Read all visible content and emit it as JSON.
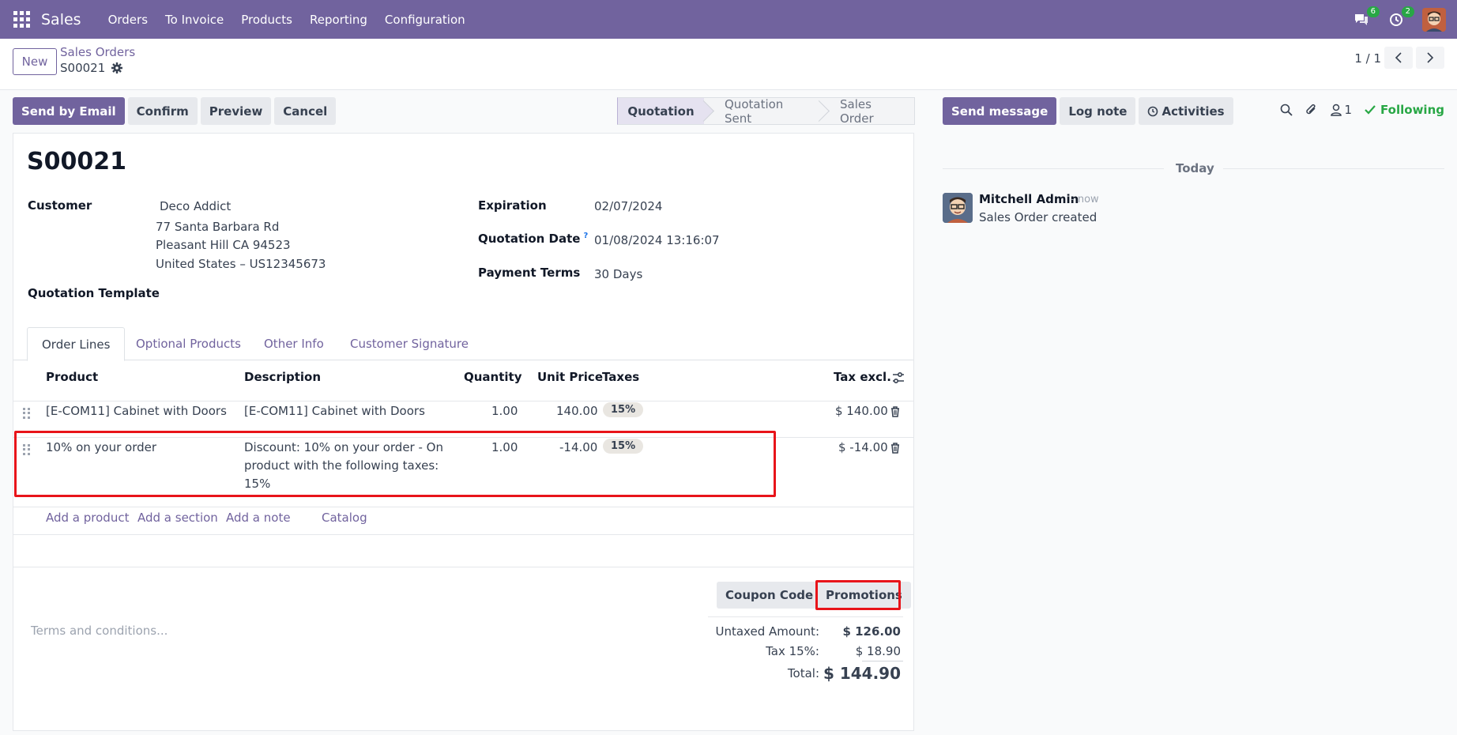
{
  "navbar": {
    "app_name": "Sales",
    "menu": [
      "Orders",
      "To Invoice",
      "Products",
      "Reporting",
      "Configuration"
    ],
    "messages_badge": "6",
    "activities_badge": "2",
    "icons": [
      "apps-grid-icon",
      "chat-icon",
      "clock-icon",
      "user-avatar"
    ]
  },
  "control_panel": {
    "new_label": "New",
    "breadcrumb_parent": "Sales Orders",
    "breadcrumb_current": "S00021",
    "pager": "1 / 1"
  },
  "actions": {
    "send_email": "Send by Email",
    "confirm": "Confirm",
    "preview": "Preview",
    "cancel": "Cancel"
  },
  "statusbar": {
    "stages": [
      "Quotation",
      "Quotation Sent",
      "Sales Order"
    ],
    "active": "Quotation"
  },
  "form": {
    "name": "S00021",
    "customer_label": "Customer",
    "customer_name": "Deco Addict",
    "customer_address_1": "77 Santa Barbara Rd",
    "customer_address_2": "Pleasant Hill CA 94523",
    "customer_address_3": "United States – US12345673",
    "template_label": "Quotation Template",
    "expiration_label": "Expiration",
    "expiration_value": "02/07/2024",
    "quotation_date_label": "Quotation Date",
    "quotation_date_help": "?",
    "quotation_date_value": "01/08/2024 13:16:07",
    "payment_terms_label": "Payment Terms",
    "payment_terms_value": "30 Days"
  },
  "tabs": [
    "Order Lines",
    "Optional Products",
    "Other Info",
    "Customer Signature"
  ],
  "order_lines": {
    "headers": {
      "product": "Product",
      "description": "Description",
      "quantity": "Quantity",
      "unit_price": "Unit Price",
      "taxes": "Taxes",
      "tax_excl": "Tax excl."
    },
    "rows": [
      {
        "product": "[E-COM11] Cabinet with Doors",
        "description_1": "[E-COM11] Cabinet with Doors",
        "description_2": "",
        "description_3": "",
        "quantity": "1.00",
        "unit_price": "140.00",
        "tax": "15%",
        "subtotal": "$ 140.00"
      },
      {
        "product": "10% on your order",
        "description_1": "Discount: 10% on your order - On",
        "description_2": "product with the following taxes:",
        "description_3": "15%",
        "quantity": "1.00",
        "unit_price": "-14.00",
        "tax": "15%",
        "subtotal": "$ -14.00"
      }
    ],
    "add_links": [
      "Add a product",
      "Add a section",
      "Add a note",
      "Catalog"
    ]
  },
  "footer": {
    "terms_placeholder": "Terms and conditions...",
    "coupon_button": "Coupon Code",
    "promotions_button": "Promotions",
    "untaxed_label": "Untaxed Amount:",
    "untaxed_value": "$ 126.00",
    "tax_label": "Tax 15%:",
    "tax_value": "$ 18.90",
    "total_label": "Total:",
    "total_value": "$ 144.90"
  },
  "chatter": {
    "send_message": "Send message",
    "log_note": "Log note",
    "activities": "Activities",
    "followers_count": "1",
    "following": "Following",
    "today": "Today",
    "author": "Mitchell Admin",
    "time": "- now",
    "body": "Sales Order created"
  },
  "colors": {
    "brand": "#71639e",
    "highlight": "#e8141a",
    "following": "#28a745"
  }
}
